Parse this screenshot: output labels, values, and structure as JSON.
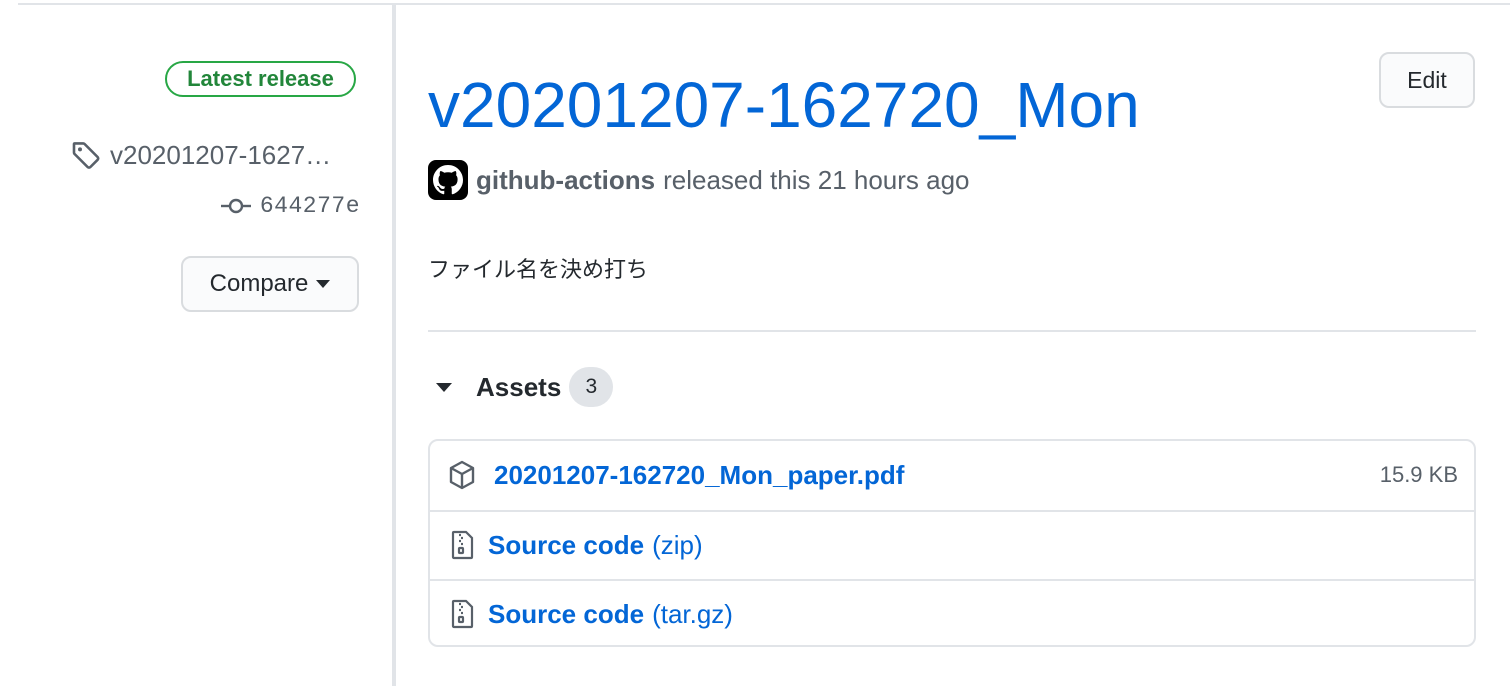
{
  "sidebar": {
    "badge": "Latest release",
    "tag": "v20201207-1627…",
    "commit": "644277e",
    "compare_label": "Compare"
  },
  "release": {
    "title": "v20201207-162720_Mon",
    "edit_label": "Edit",
    "author": "github-actions",
    "released_text": "released this 21 hours ago",
    "body": "ファイル名を決め打ち"
  },
  "assets": {
    "label": "Assets",
    "count": "3",
    "items": [
      {
        "name": "20201207-162720_Mon_paper.pdf",
        "suffix": "",
        "size": "15.9 KB",
        "icon": "package-icon"
      },
      {
        "name": "Source code",
        "suffix": "(zip)",
        "size": "",
        "icon": "file-zip-icon"
      },
      {
        "name": "Source code",
        "suffix": "(tar.gz)",
        "size": "",
        "icon": "file-zip-icon"
      }
    ]
  },
  "colors": {
    "link": "#0366d6",
    "badge_green": "#28a745",
    "muted": "#586069"
  }
}
